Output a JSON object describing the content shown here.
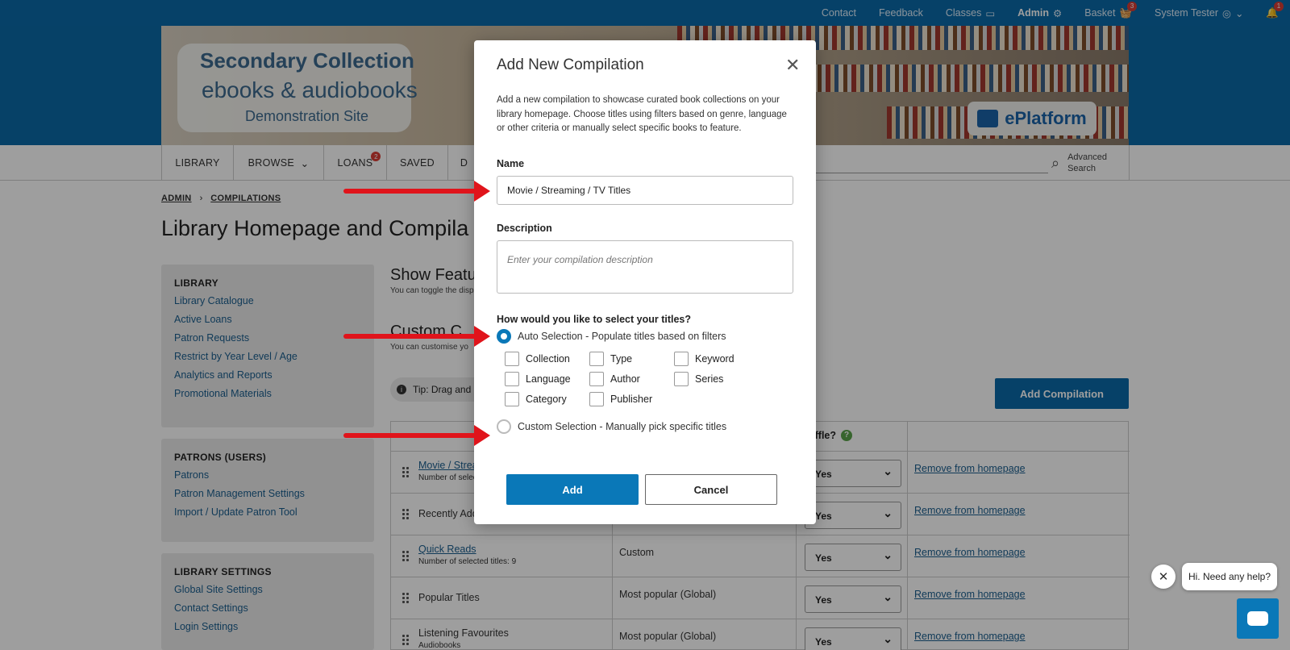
{
  "topbar": {
    "links": [
      "Contact",
      "Feedback",
      "Classes"
    ],
    "admin": "Admin",
    "basket": "Basket",
    "basket_count": "3",
    "user": "System Tester",
    "notif_count": "1"
  },
  "banner": {
    "title": "Secondary Collection",
    "subtitle": "ebooks & audiobooks",
    "site": "Demonstration Site",
    "brand": "ePlatform"
  },
  "nav": {
    "items": [
      "LIBRARY",
      "BROWSE",
      "LOANS",
      "SAVED",
      "D"
    ],
    "loans_badge": "2",
    "search": "Advanced Search"
  },
  "breadcrumb": [
    "ADMIN",
    "COMPILATIONS"
  ],
  "page_title": "Library Homepage and Compila",
  "sidebar": {
    "library": {
      "heading": "LIBRARY",
      "items": [
        "Library Catalogue",
        "Active Loans",
        "Patron Requests",
        "Restrict by Year Level / Age",
        "Analytics and Reports",
        "Promotional Materials"
      ]
    },
    "patrons": {
      "heading": "PATRONS (USERS)",
      "items": [
        "Patrons",
        "Patron Management Settings",
        "Import / Update Patron Tool"
      ]
    },
    "settings": {
      "heading": "LIBRARY SETTINGS",
      "items": [
        "Global Site Settings",
        "Contact Settings",
        "Login Settings"
      ]
    }
  },
  "content": {
    "show_heading": "Show Featu",
    "show_sub": "You can toggle the disp",
    "custom_heading": "Custom C",
    "custom_sub": "You can customise yo",
    "tip": "Tip: Drag and c",
    "add_compilation": "Add Compilation",
    "shuffle_header": "uffle?",
    "rows": [
      {
        "name": "Movie / Strea",
        "sub": "Number of selec",
        "type": "",
        "shuffle": "Yes",
        "remove": "Remove from homepage"
      },
      {
        "name": "Recently Add",
        "sub": "",
        "type": "",
        "shuffle": "Yes",
        "remove": "Remove from homepage"
      },
      {
        "name": "Quick Reads",
        "sub": "Number of selected titles: 9",
        "type": "Custom",
        "shuffle": "Yes",
        "remove": "Remove from homepage"
      },
      {
        "name": "Popular Titles",
        "sub": "",
        "type": "Most popular (Global)",
        "shuffle": "Yes",
        "remove": "Remove from homepage"
      },
      {
        "name": "Listening Favourites",
        "sub": "Audiobooks",
        "type": "Most popular (Global)",
        "shuffle": "Yes",
        "remove": "Remove from homepage"
      }
    ]
  },
  "chat": {
    "message": "Hi. Need any help?"
  },
  "modal": {
    "title": "Add New Compilation",
    "intro": "Add a new compilation to showcase curated book collections on your library homepage. Choose titles using filters based on genre, language or other criteria or manually select specific books to feature.",
    "name_label": "Name",
    "name_value": "Movie / Streaming / TV Titles",
    "description_label": "Description",
    "description_placeholder": "Enter your compilation description",
    "select_question": "How would you like to select your titles?",
    "auto_option": "Auto Selection - Populate titles based on filters",
    "custom_option": "Custom Selection - Manually pick specific titles",
    "filters": [
      "Collection",
      "Type",
      "Keyword",
      "Language",
      "Author",
      "Series",
      "Category",
      "Publisher"
    ],
    "add": "Add",
    "cancel": "Cancel"
  }
}
